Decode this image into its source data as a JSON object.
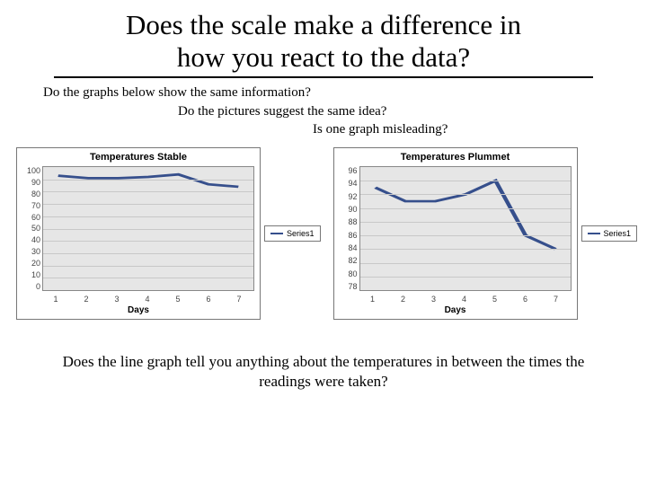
{
  "title": "Does the scale make a difference in how you react to the data?",
  "questions": {
    "q1": "Do the graphs below show the same information?",
    "q2": "Do the pictures suggest the same idea?",
    "q3": "Is one graph misleading?"
  },
  "chart_data": [
    {
      "type": "line",
      "title": "Temperatures Stable",
      "xlabel": "Days",
      "ylabel": "",
      "ylim": [
        0,
        100
      ],
      "yticks": [
        0,
        10,
        20,
        30,
        40,
        50,
        60,
        70,
        80,
        90,
        100
      ],
      "categories": [
        1,
        2,
        3,
        4,
        5,
        6,
        7
      ],
      "series": [
        {
          "name": "Series1",
          "values": [
            93,
            91,
            91,
            92,
            94,
            86,
            84
          ]
        }
      ]
    },
    {
      "type": "line",
      "title": "Temperatures Plummet",
      "xlabel": "Days",
      "ylabel": "",
      "ylim": [
        78,
        96
      ],
      "yticks": [
        78,
        80,
        82,
        84,
        86,
        88,
        90,
        92,
        94,
        96
      ],
      "categories": [
        1,
        2,
        3,
        4,
        5,
        6,
        7
      ],
      "series": [
        {
          "name": "Series1",
          "values": [
            93,
            91,
            91,
            92,
            94,
            86,
            84
          ]
        }
      ]
    }
  ],
  "bottom_question": "Does the line graph tell you anything about the temperatures in between the times the readings were taken?"
}
